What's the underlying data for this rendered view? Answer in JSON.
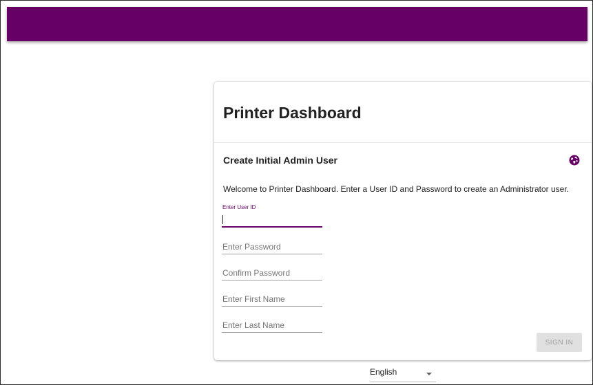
{
  "card": {
    "title": "Printer Dashboard",
    "section_title": "Create Initial Admin User",
    "welcome_text": "Welcome to Printer Dashboard. Enter a User ID and Password to create an Administrator user."
  },
  "form": {
    "user_id": {
      "label": "Enter User ID",
      "value": ""
    },
    "password": {
      "placeholder": "Enter Password"
    },
    "confirm_password": {
      "placeholder": "Confirm Password"
    },
    "first_name": {
      "placeholder": "Enter First Name"
    },
    "last_name": {
      "placeholder": "Enter Last Name"
    },
    "submit_label": "SIGN IN"
  },
  "language": {
    "selected": "English"
  },
  "icons": {
    "language": "globe-icon",
    "dropdown": "chevron-down-icon"
  },
  "colors": {
    "brand": "#660066",
    "disabled_button_bg": "#e0e0e0",
    "disabled_button_text": "#9e9e9e"
  }
}
